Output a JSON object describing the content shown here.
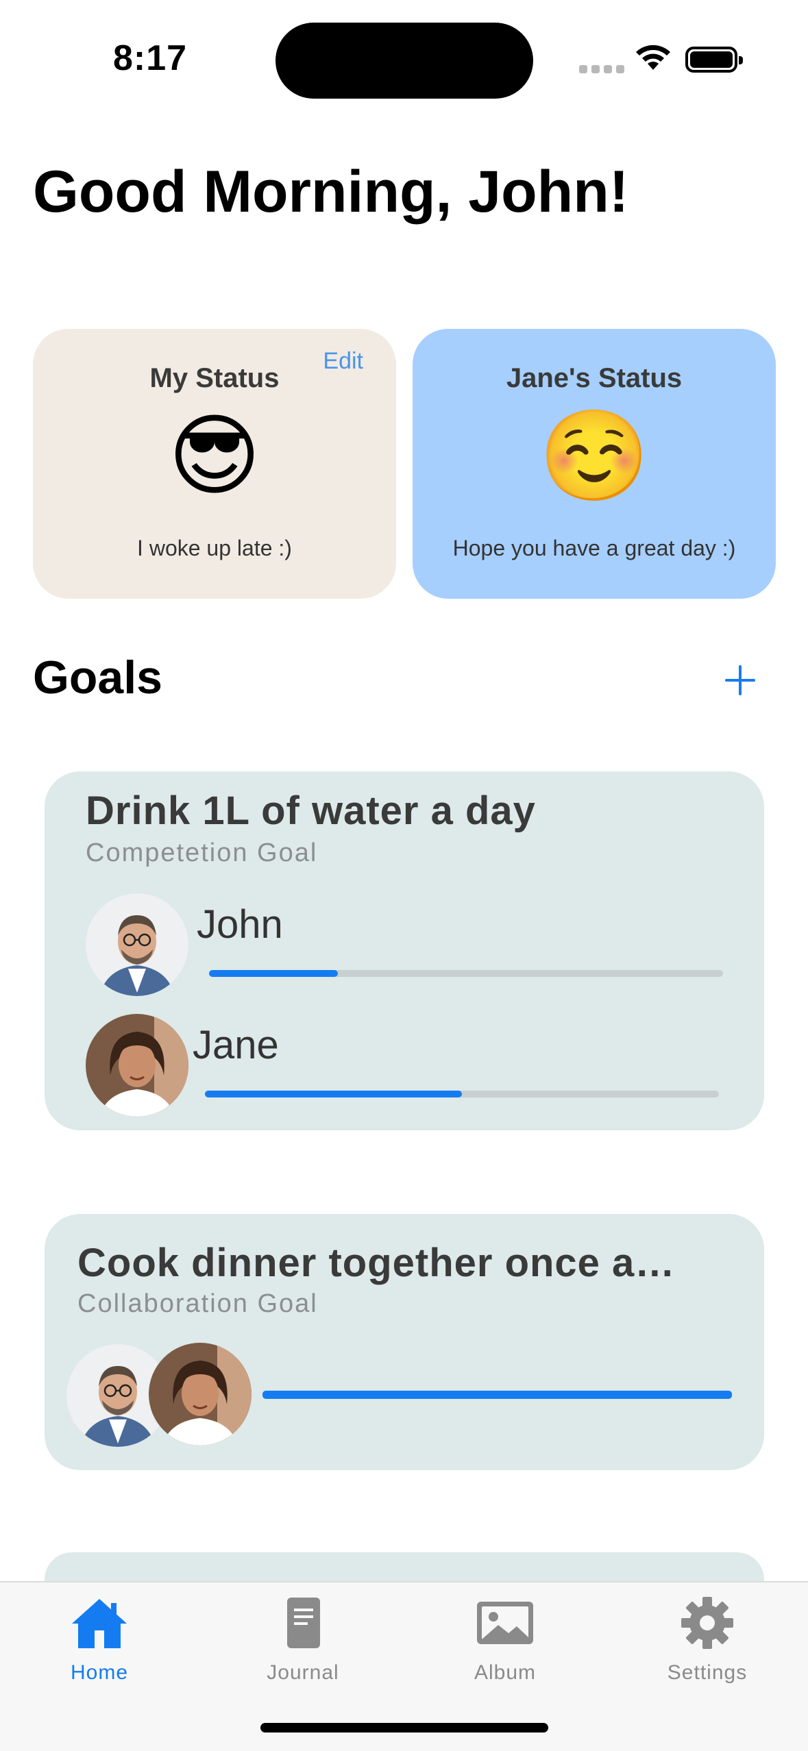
{
  "status_bar": {
    "time": "8:17"
  },
  "greeting": "Good Morning, John!",
  "my_status": {
    "title": "My Status",
    "edit_label": "Edit",
    "emoji": "😎",
    "note": "I woke up late :)"
  },
  "jane_status": {
    "title": "Jane's Status",
    "emoji": "☺️",
    "note": "Hope you have a great day :)"
  },
  "goals": {
    "title": "Goals",
    "items": [
      {
        "title": "Drink 1L of water a day",
        "type": "Competetion Goal",
        "participants": [
          {
            "name": "John",
            "progress": 0.25
          },
          {
            "name": "Jane",
            "progress": 0.5
          }
        ]
      },
      {
        "title": "Cook dinner together once a…",
        "type": "Collaboration Goal",
        "progress": 1.0
      }
    ]
  },
  "tabs": [
    {
      "label": "Home",
      "icon": "house-icon",
      "active": true
    },
    {
      "label": "Journal",
      "icon": "document-icon",
      "active": false
    },
    {
      "label": "Album",
      "icon": "photo-icon",
      "active": false
    },
    {
      "label": "Settings",
      "icon": "gear-icon",
      "active": false
    }
  ],
  "colors": {
    "accent": "#147cf0",
    "my_status_bg": "#f2ebe3",
    "jane_status_bg": "#a6cffd",
    "goal_card_bg": "#dee9e9"
  }
}
